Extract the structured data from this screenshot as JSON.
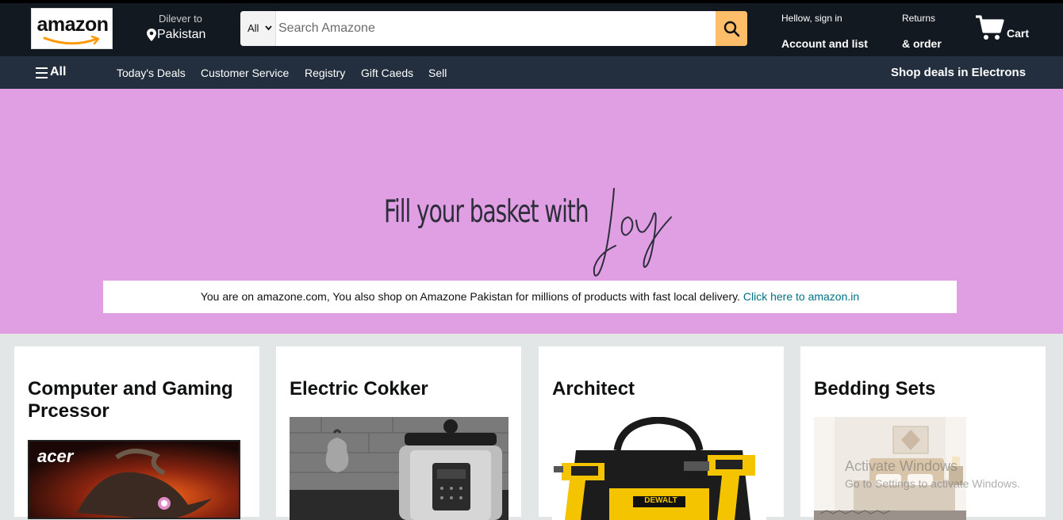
{
  "header": {
    "logo_text": "amazon",
    "deliver_label": "Dilever to",
    "deliver_location": "Pakistan",
    "search_category": "All",
    "search_placeholder": "Search Amazone",
    "account_greeting": "Hellow, sign in",
    "account_label": "Account and list",
    "returns_label": "Returns",
    "orders_label": "& order",
    "cart_label": "Cart"
  },
  "nav": {
    "all_label": "All",
    "items": [
      {
        "label": "Today's Deals"
      },
      {
        "label": "Customer Service"
      },
      {
        "label": "Registry"
      },
      {
        "label": "Gift Caeds"
      },
      {
        "label": "Sell"
      }
    ],
    "deals_label": "Shop deals in Electrons"
  },
  "hero": {
    "headline": "Fill your basket with",
    "headline_script": "joy",
    "background_color": "#e09fe3"
  },
  "notice": {
    "text": "You are on amazone.com, You also shop on Amazone Pakistan for millions of products with fast local delivery.",
    "link": "Click here to amazon.in"
  },
  "cards": [
    {
      "title": "Computer and Gaming Prcessor",
      "image": "acer-laptop-image",
      "brand_text": "acer"
    },
    {
      "title": "Electric Cokker",
      "image": "pressure-cooker-image"
    },
    {
      "title": "Architect",
      "image": "dewalt-drill-kit-image",
      "brand_text": "DEWALT"
    },
    {
      "title": "Bedding Sets",
      "image": "bedroom-image"
    }
  ],
  "watermark": {
    "line1": "Activate Windows",
    "line2": "Go to Settings to activate Windows."
  },
  "colors": {
    "header_bg": "#131921",
    "nav_bg": "#232f3e",
    "search_button": "#febd69",
    "link": "#007185",
    "page_bg": "#e3e6e6"
  }
}
